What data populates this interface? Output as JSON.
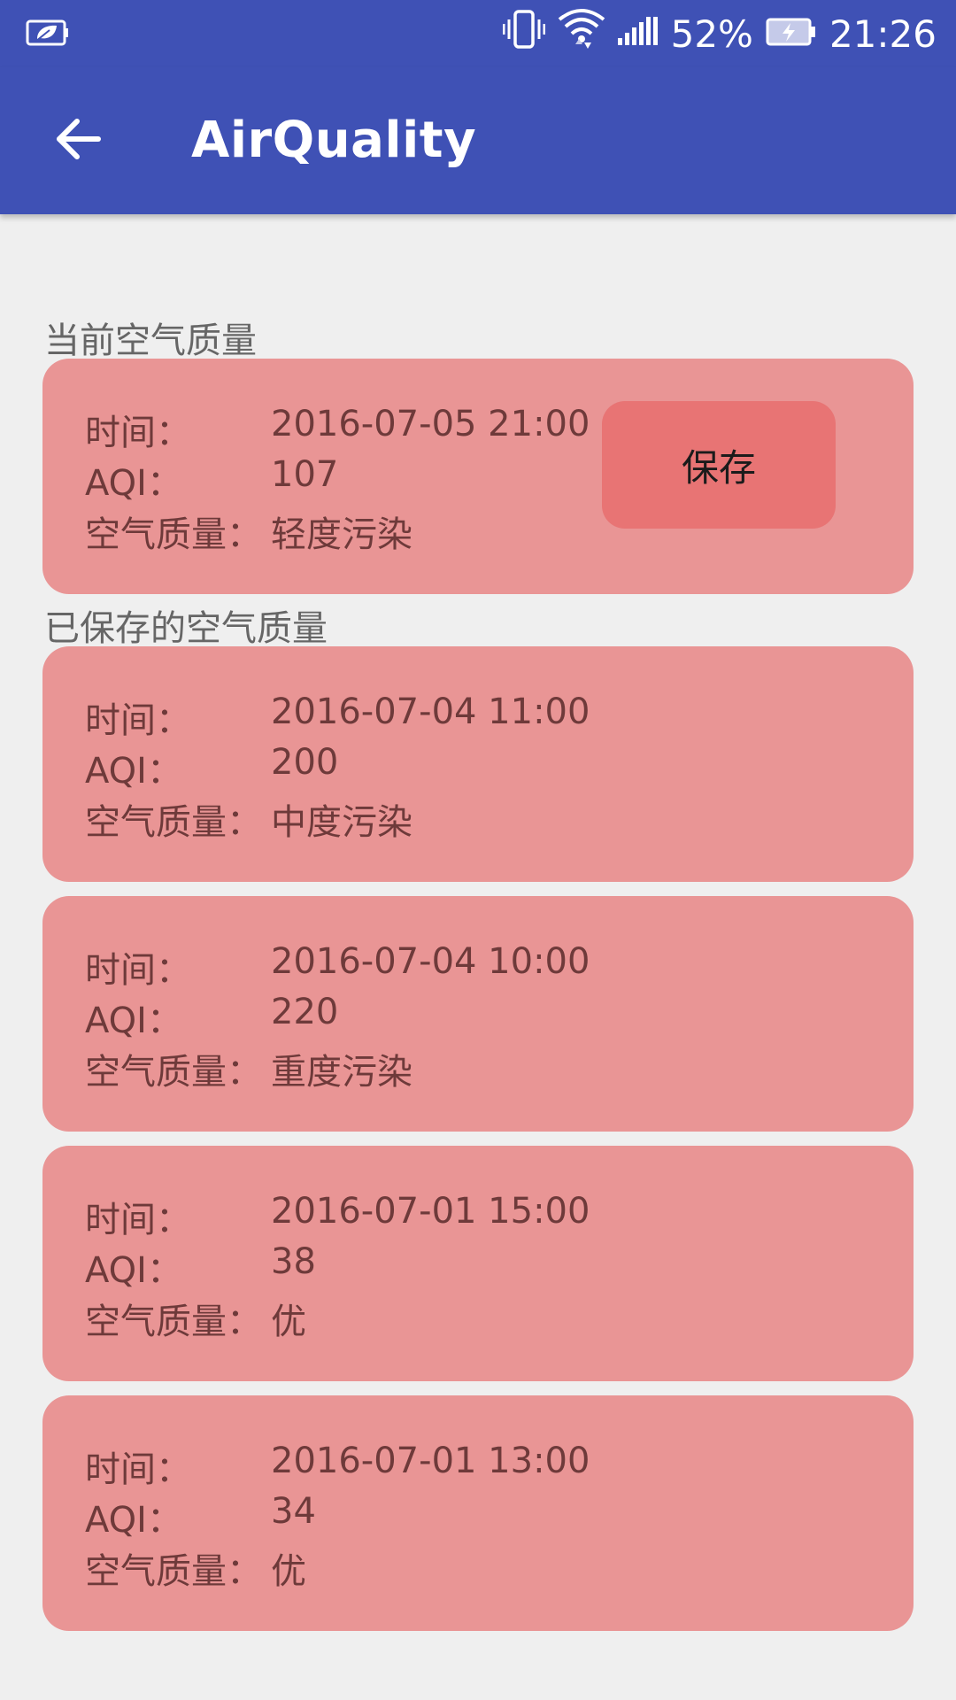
{
  "status_bar": {
    "battery_percent": "52%",
    "time": "21:26",
    "icons": [
      "leaf-battery-saver-icon",
      "vibrate-icon",
      "wifi-icon",
      "signal-icon",
      "battery-charging-icon"
    ]
  },
  "app_bar": {
    "title": "AirQuality",
    "back_icon": "arrow-back-icon"
  },
  "current": {
    "section_label": "当前空气质量",
    "time_label": "时间：",
    "time_value": "2016-07-05 21:00",
    "aqi_label": "AQI：",
    "aqi_value": "107",
    "quality_label": "空气质量：",
    "quality_value": "轻度污染",
    "save_label": "保存"
  },
  "saved": {
    "section_label": "已保存的空气质量",
    "items": [
      {
        "time_label": "时间：",
        "time_value": "2016-07-04 11:00",
        "aqi_label": "AQI：",
        "aqi_value": "200",
        "quality_label": "空气质量：",
        "quality_value": "中度污染"
      },
      {
        "time_label": "时间：",
        "time_value": "2016-07-04 10:00",
        "aqi_label": "AQI：",
        "aqi_value": "220",
        "quality_label": "空气质量：",
        "quality_value": "重度污染"
      },
      {
        "time_label": "时间：",
        "time_value": "2016-07-01 15:00",
        "aqi_label": "AQI：",
        "aqi_value": "38",
        "quality_label": "空气质量：",
        "quality_value": "优"
      },
      {
        "time_label": "时间：",
        "time_value": "2016-07-01 13:00",
        "aqi_label": "AQI：",
        "aqi_value": "34",
        "quality_label": "空气质量：",
        "quality_value": "优"
      }
    ]
  },
  "colors": {
    "app_bar": "#3f51b5",
    "card": "#e99595",
    "save_button": "#e87474",
    "background": "#efefef"
  }
}
